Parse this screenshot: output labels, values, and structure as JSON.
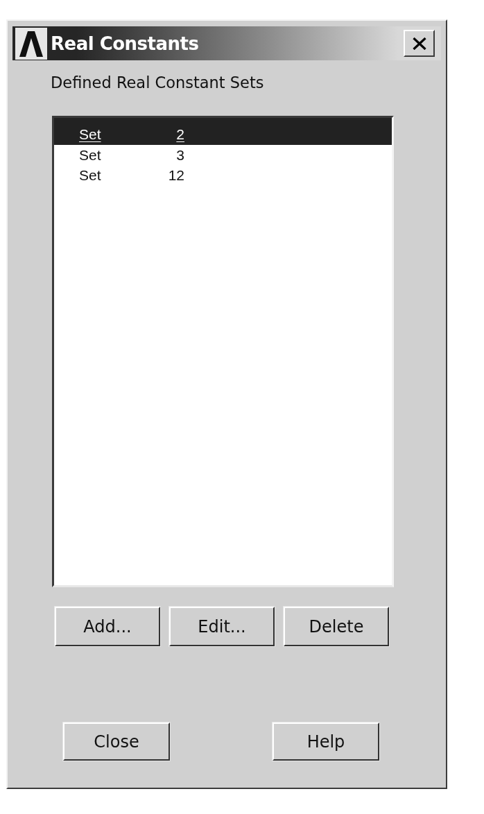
{
  "window": {
    "title": "Real Constants"
  },
  "list": {
    "label": "Defined Real Constant Sets",
    "items": [
      {
        "name": "Set",
        "number": "2",
        "selected": true
      },
      {
        "name": "Set",
        "number": "3",
        "selected": false
      },
      {
        "name": "Set",
        "number": "12",
        "selected": false
      }
    ]
  },
  "action_buttons": [
    "Add...",
    "Edit...",
    "Delete"
  ],
  "footer_buttons": [
    "Close",
    "Help"
  ]
}
